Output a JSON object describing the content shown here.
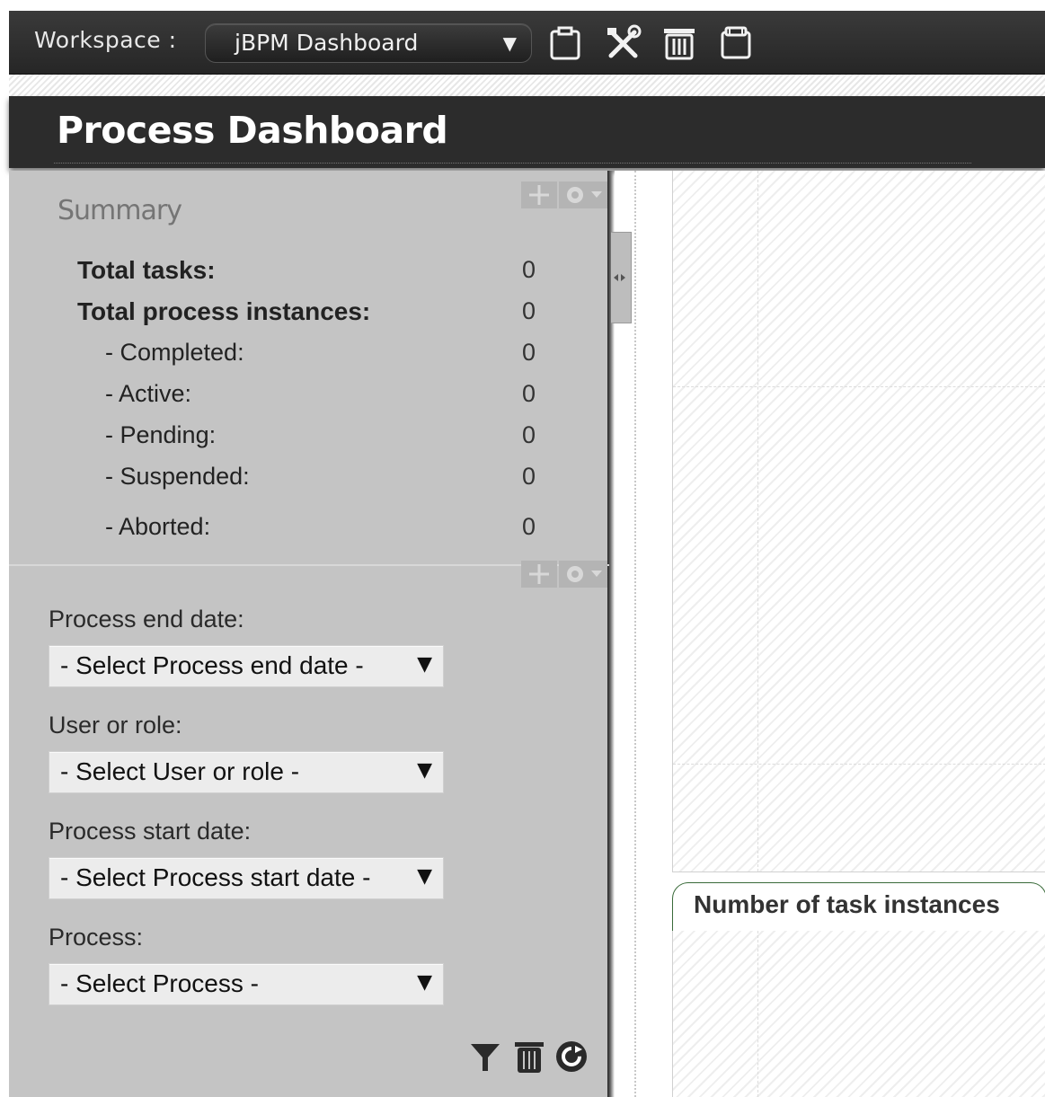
{
  "toolbar": {
    "workspace_label": "Workspace :",
    "workspace_value": "jBPM Dashboard",
    "icons": [
      "page-icon",
      "tools-icon",
      "trash-icon",
      "clipboard-icon"
    ]
  },
  "header": {
    "title": "Process Dashboard"
  },
  "summary": {
    "title": "Summary",
    "rows": [
      {
        "label": "Total tasks:",
        "value": "0"
      },
      {
        "label": "Total process instances:",
        "value": "0"
      },
      {
        "label": "- Completed:",
        "value": "0"
      },
      {
        "label": "- Active:",
        "value": "0"
      },
      {
        "label": "- Pending:",
        "value": "0"
      },
      {
        "label": "- Suspended:",
        "value": "0"
      },
      {
        "label": "- Aborted:",
        "value": "0"
      }
    ]
  },
  "filters": [
    {
      "label": "Process end date:",
      "value": "- Select Process end date -"
    },
    {
      "label": "User or role:",
      "value": "- Select User or role -"
    },
    {
      "label": "Process start date:",
      "value": "- Select Process start date -"
    },
    {
      "label": "Process:",
      "value": "- Select Process -"
    }
  ],
  "filter_actions": [
    "filter-icon",
    "trash-icon",
    "refresh-icon"
  ],
  "chart_tab": {
    "label": "Number of task instances"
  },
  "colors": {
    "toolbar_bg": "#2a2a2a",
    "panel_bg": "#c4c4c4",
    "tab_border": "#3a6b3a"
  }
}
